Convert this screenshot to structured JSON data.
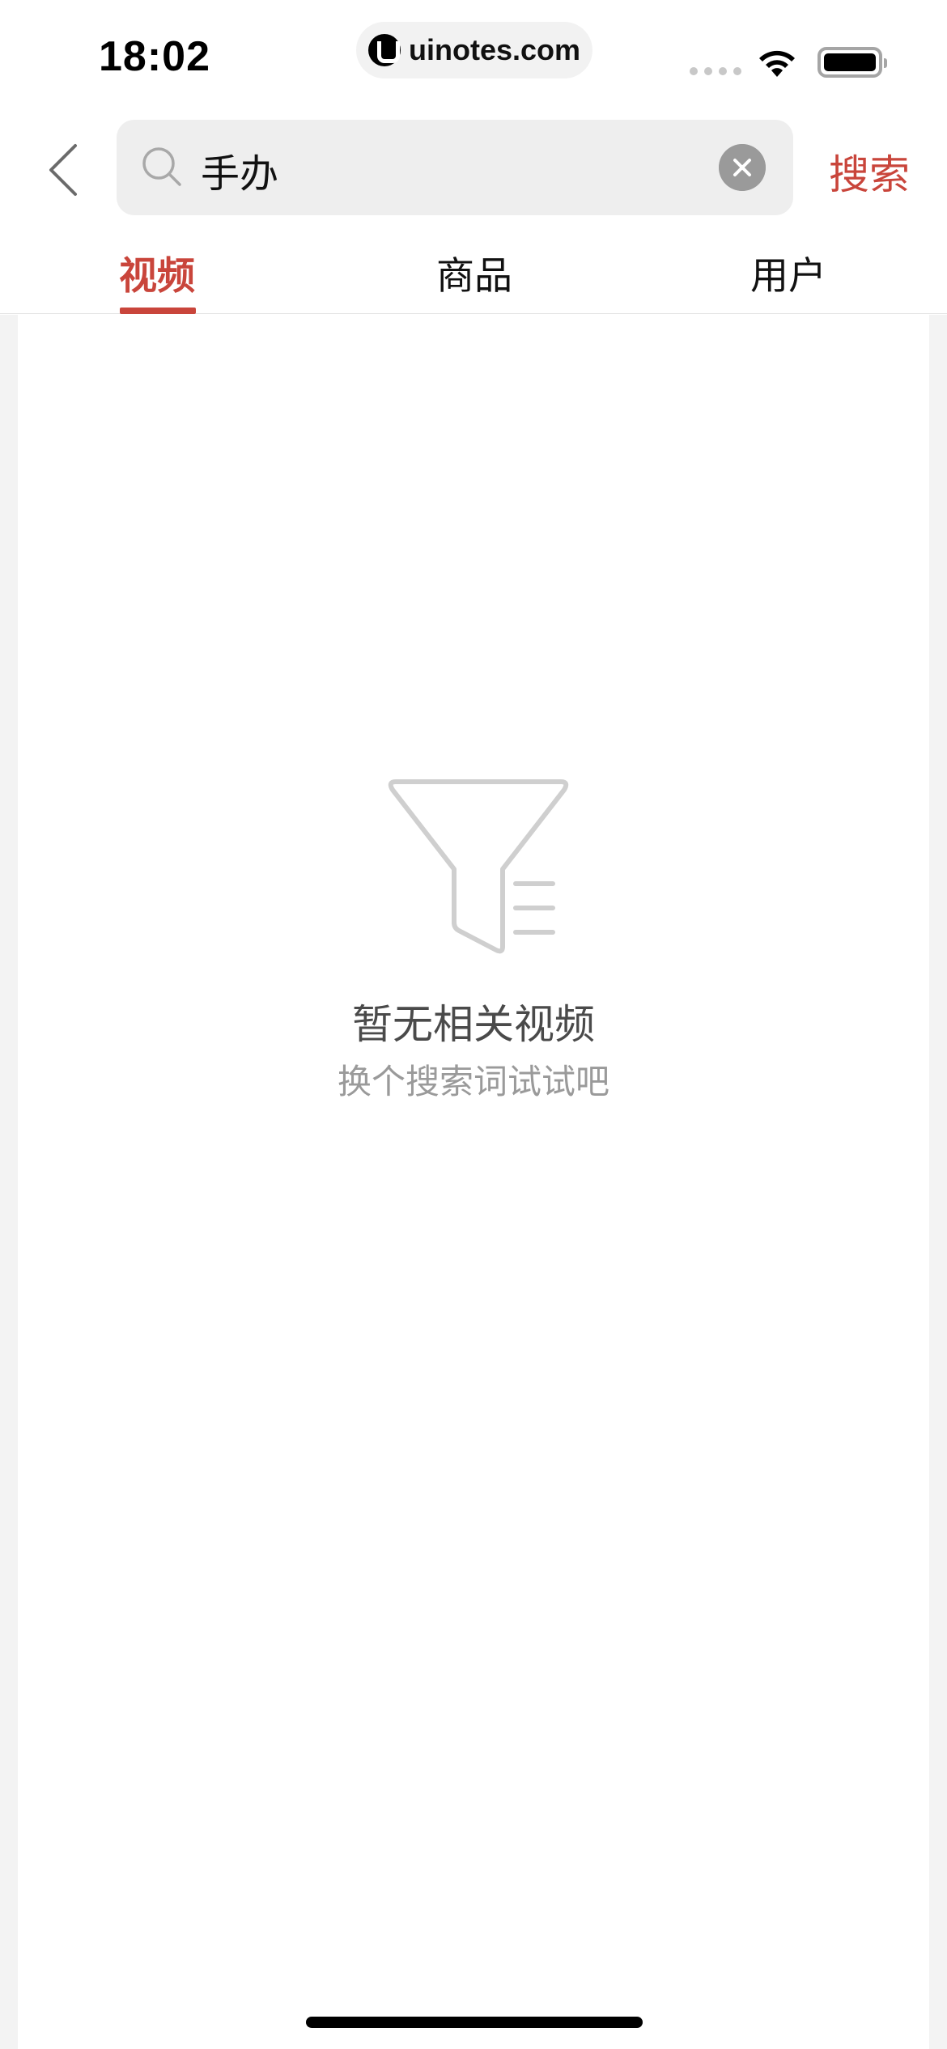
{
  "status_bar": {
    "time": "18:02",
    "url": "uinotes.com"
  },
  "search": {
    "query": "手办",
    "submit_label": "搜索"
  },
  "tabs": [
    {
      "label": "视频",
      "active": true
    },
    {
      "label": "商品",
      "active": false
    },
    {
      "label": "用户",
      "active": false
    }
  ],
  "empty_state": {
    "title": "暂无相关视频",
    "subtitle": "换个搜索词试试吧",
    "icon": "funnel-icon"
  },
  "colors": {
    "accent": "#c9453b",
    "background": "#f3f3f3"
  }
}
